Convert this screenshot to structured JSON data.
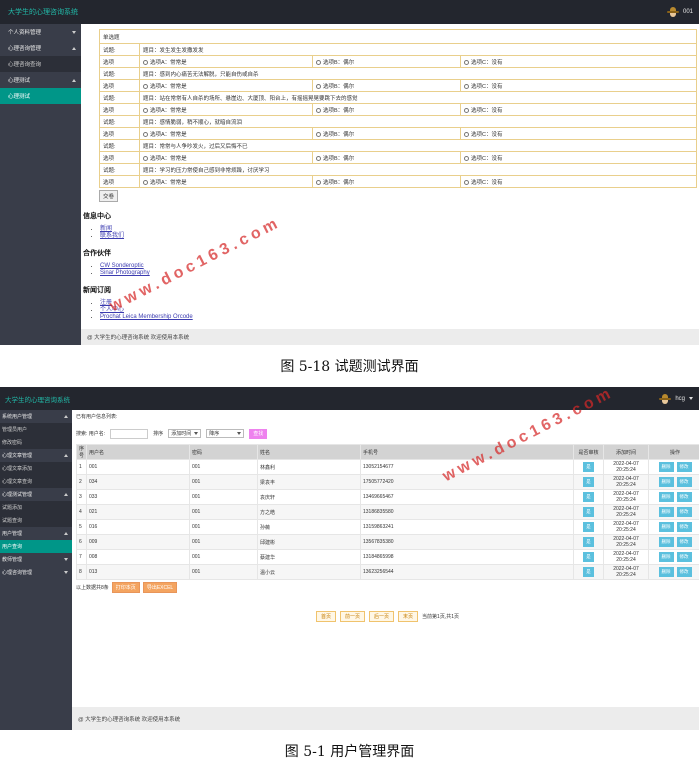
{
  "shot1": {
    "app_title": "大学生的心理咨询系统",
    "username": "001",
    "sidebar": [
      {
        "label": "个人资料管理",
        "expanded": false,
        "children": []
      },
      {
        "label": "心理咨询管理",
        "expanded": true,
        "children": [
          {
            "label": "心理咨询查询",
            "active": false
          }
        ]
      },
      {
        "label": "心理测试",
        "expanded": true,
        "children": [
          {
            "label": "心理测试",
            "active": true
          }
        ]
      }
    ],
    "quiz": {
      "section_title": "单选题",
      "question_label": "试题:",
      "options_label": "选项",
      "questions": [
        {
          "title": "题目：发生发生发撒发发",
          "a": "选项A：常常是",
          "b": "选项B：偶尔",
          "c": "选项C：没有"
        },
        {
          "title": "题目：感到内心痛苦无法解脱，只能自伤或自杀",
          "a": "选项A：常常是",
          "b": "选项B：偶尔",
          "c": "选项C：没有"
        },
        {
          "title": "题目：站在常常有人自杀的场所、悬崖边、大厦顶、阳台上，有摇摇晃晃要跳下去的感觉",
          "a": "选项A：常常是",
          "b": "选项B：偶尔",
          "c": "选项C：没有"
        },
        {
          "title": "题目：感情脆弱，稍不顺心，就暗自流泪",
          "a": "选项A：常常是",
          "b": "选项B：偶尔",
          "c": "选项C：没有"
        },
        {
          "title": "题目：常常与人争吵发火，过后又后悔不已",
          "a": "选项A：常常是",
          "b": "选项B：偶尔",
          "c": "选项C：没有"
        },
        {
          "title": "题目：学习的压力常使自己感到非常烦躁，讨厌学习",
          "a": "选项A：常常是",
          "b": "选项B：偶尔",
          "c": "选项C：没有"
        }
      ],
      "submit_label": "交卷"
    },
    "footer_sections": [
      {
        "title": "信息中心",
        "links": [
          "新闻",
          "联系我们"
        ]
      },
      {
        "title": "合作伙伴",
        "links": [
          "CW Sonderoptic",
          "Sinar Photography"
        ]
      },
      {
        "title": "新闻订阅",
        "links": [
          "注册",
          "个人中心",
          "Prochat Leica Membership Orcode"
        ]
      }
    ],
    "bottom_bar": "@ 大学生的心理咨询系统 欢迎使用本系统",
    "caption": "图 5-18  试题测试界面"
  },
  "shot2": {
    "app_title": "大学生的心理咨询系统",
    "username": "hcg",
    "sidebar": [
      {
        "label": "系统用户管理",
        "expanded": true,
        "children": [
          {
            "label": "管理员用户",
            "active": false
          },
          {
            "label": "修改密码",
            "active": false
          }
        ]
      },
      {
        "label": "心理文章管理",
        "expanded": true,
        "children": [
          {
            "label": "心理文章添加",
            "active": false
          },
          {
            "label": "心理文章查询",
            "active": false
          }
        ]
      },
      {
        "label": "心理测试管理",
        "expanded": true,
        "children": [
          {
            "label": "试题添加",
            "active": false
          },
          {
            "label": "试题查询",
            "active": false
          }
        ]
      },
      {
        "label": "用户管理",
        "expanded": true,
        "children": [
          {
            "label": "用户查询",
            "active": true
          }
        ]
      },
      {
        "label": "教师管理",
        "expanded": false,
        "children": []
      },
      {
        "label": "心理咨询管理",
        "expanded": false,
        "children": []
      }
    ],
    "list_title": "已有用户信息列表:",
    "search": {
      "label": "搜索: 用户名:",
      "sort_label": "排序",
      "sort_field": "添加时间",
      "sort_order": "降序",
      "button": "查找"
    },
    "table": {
      "headers": [
        "序号",
        "用户名",
        "密码",
        "姓名",
        "手机号",
        "是否审核",
        "添加时间",
        "操作"
      ],
      "rows": [
        {
          "no": "1",
          "username": "001",
          "password": "001",
          "name": "林鑫利",
          "phone": "13052154677",
          "audit": "是",
          "date": "2022-04-07",
          "time": "20:25:24"
        },
        {
          "no": "2",
          "username": "034",
          "password": "001",
          "name": "梁袁丰",
          "phone": "17505772420",
          "audit": "是",
          "date": "2022-04-07",
          "time": "20:25:24"
        },
        {
          "no": "3",
          "username": "033",
          "password": "001",
          "name": "袁庆轩",
          "phone": "13469665467",
          "audit": "是",
          "date": "2022-04-07",
          "time": "20:25:24"
        },
        {
          "no": "4",
          "username": "021",
          "password": "001",
          "name": "方之皓",
          "phone": "13186835580",
          "audit": "是",
          "date": "2022-04-07",
          "time": "20:25:24"
        },
        {
          "no": "5",
          "username": "016",
          "password": "001",
          "name": "孙薇",
          "phone": "13159863241",
          "audit": "是",
          "date": "2022-04-07",
          "time": "20:25:24"
        },
        {
          "no": "6",
          "username": "009",
          "password": "001",
          "name": "邱建彬",
          "phone": "13567835380",
          "audit": "是",
          "date": "2022-04-07",
          "time": "20:25:24"
        },
        {
          "no": "7",
          "username": "008",
          "password": "001",
          "name": "蔡建华",
          "phone": "13184865998",
          "audit": "是",
          "date": "2022-04-07",
          "time": "20:25:24"
        },
        {
          "no": "8",
          "username": "013",
          "password": "001",
          "name": "温小云",
          "phone": "13623256544",
          "audit": "是",
          "date": "2022-04-07",
          "time": "20:25:24"
        }
      ],
      "action_delete": "删除",
      "action_edit": "修改"
    },
    "bulk": {
      "count_text": "以上数据共8条",
      "export_excel": "打印本页",
      "export_all": "导出EXCEL"
    },
    "pager": {
      "first": "首页",
      "prev": "前一页",
      "next": "后一页",
      "last": "末页",
      "info": "当前第1页,共1页"
    },
    "bottom_bar": "@ 大学生的心理咨询系统 欢迎使用本系统",
    "caption": "图 5-1  用户管理界面"
  },
  "watermark": "www.doc163.com",
  "colors": {
    "topbar": "#23262e",
    "sidebar": "#393d49",
    "active": "#009688",
    "logo": "#22b9a8",
    "watermark": "#d62828"
  }
}
